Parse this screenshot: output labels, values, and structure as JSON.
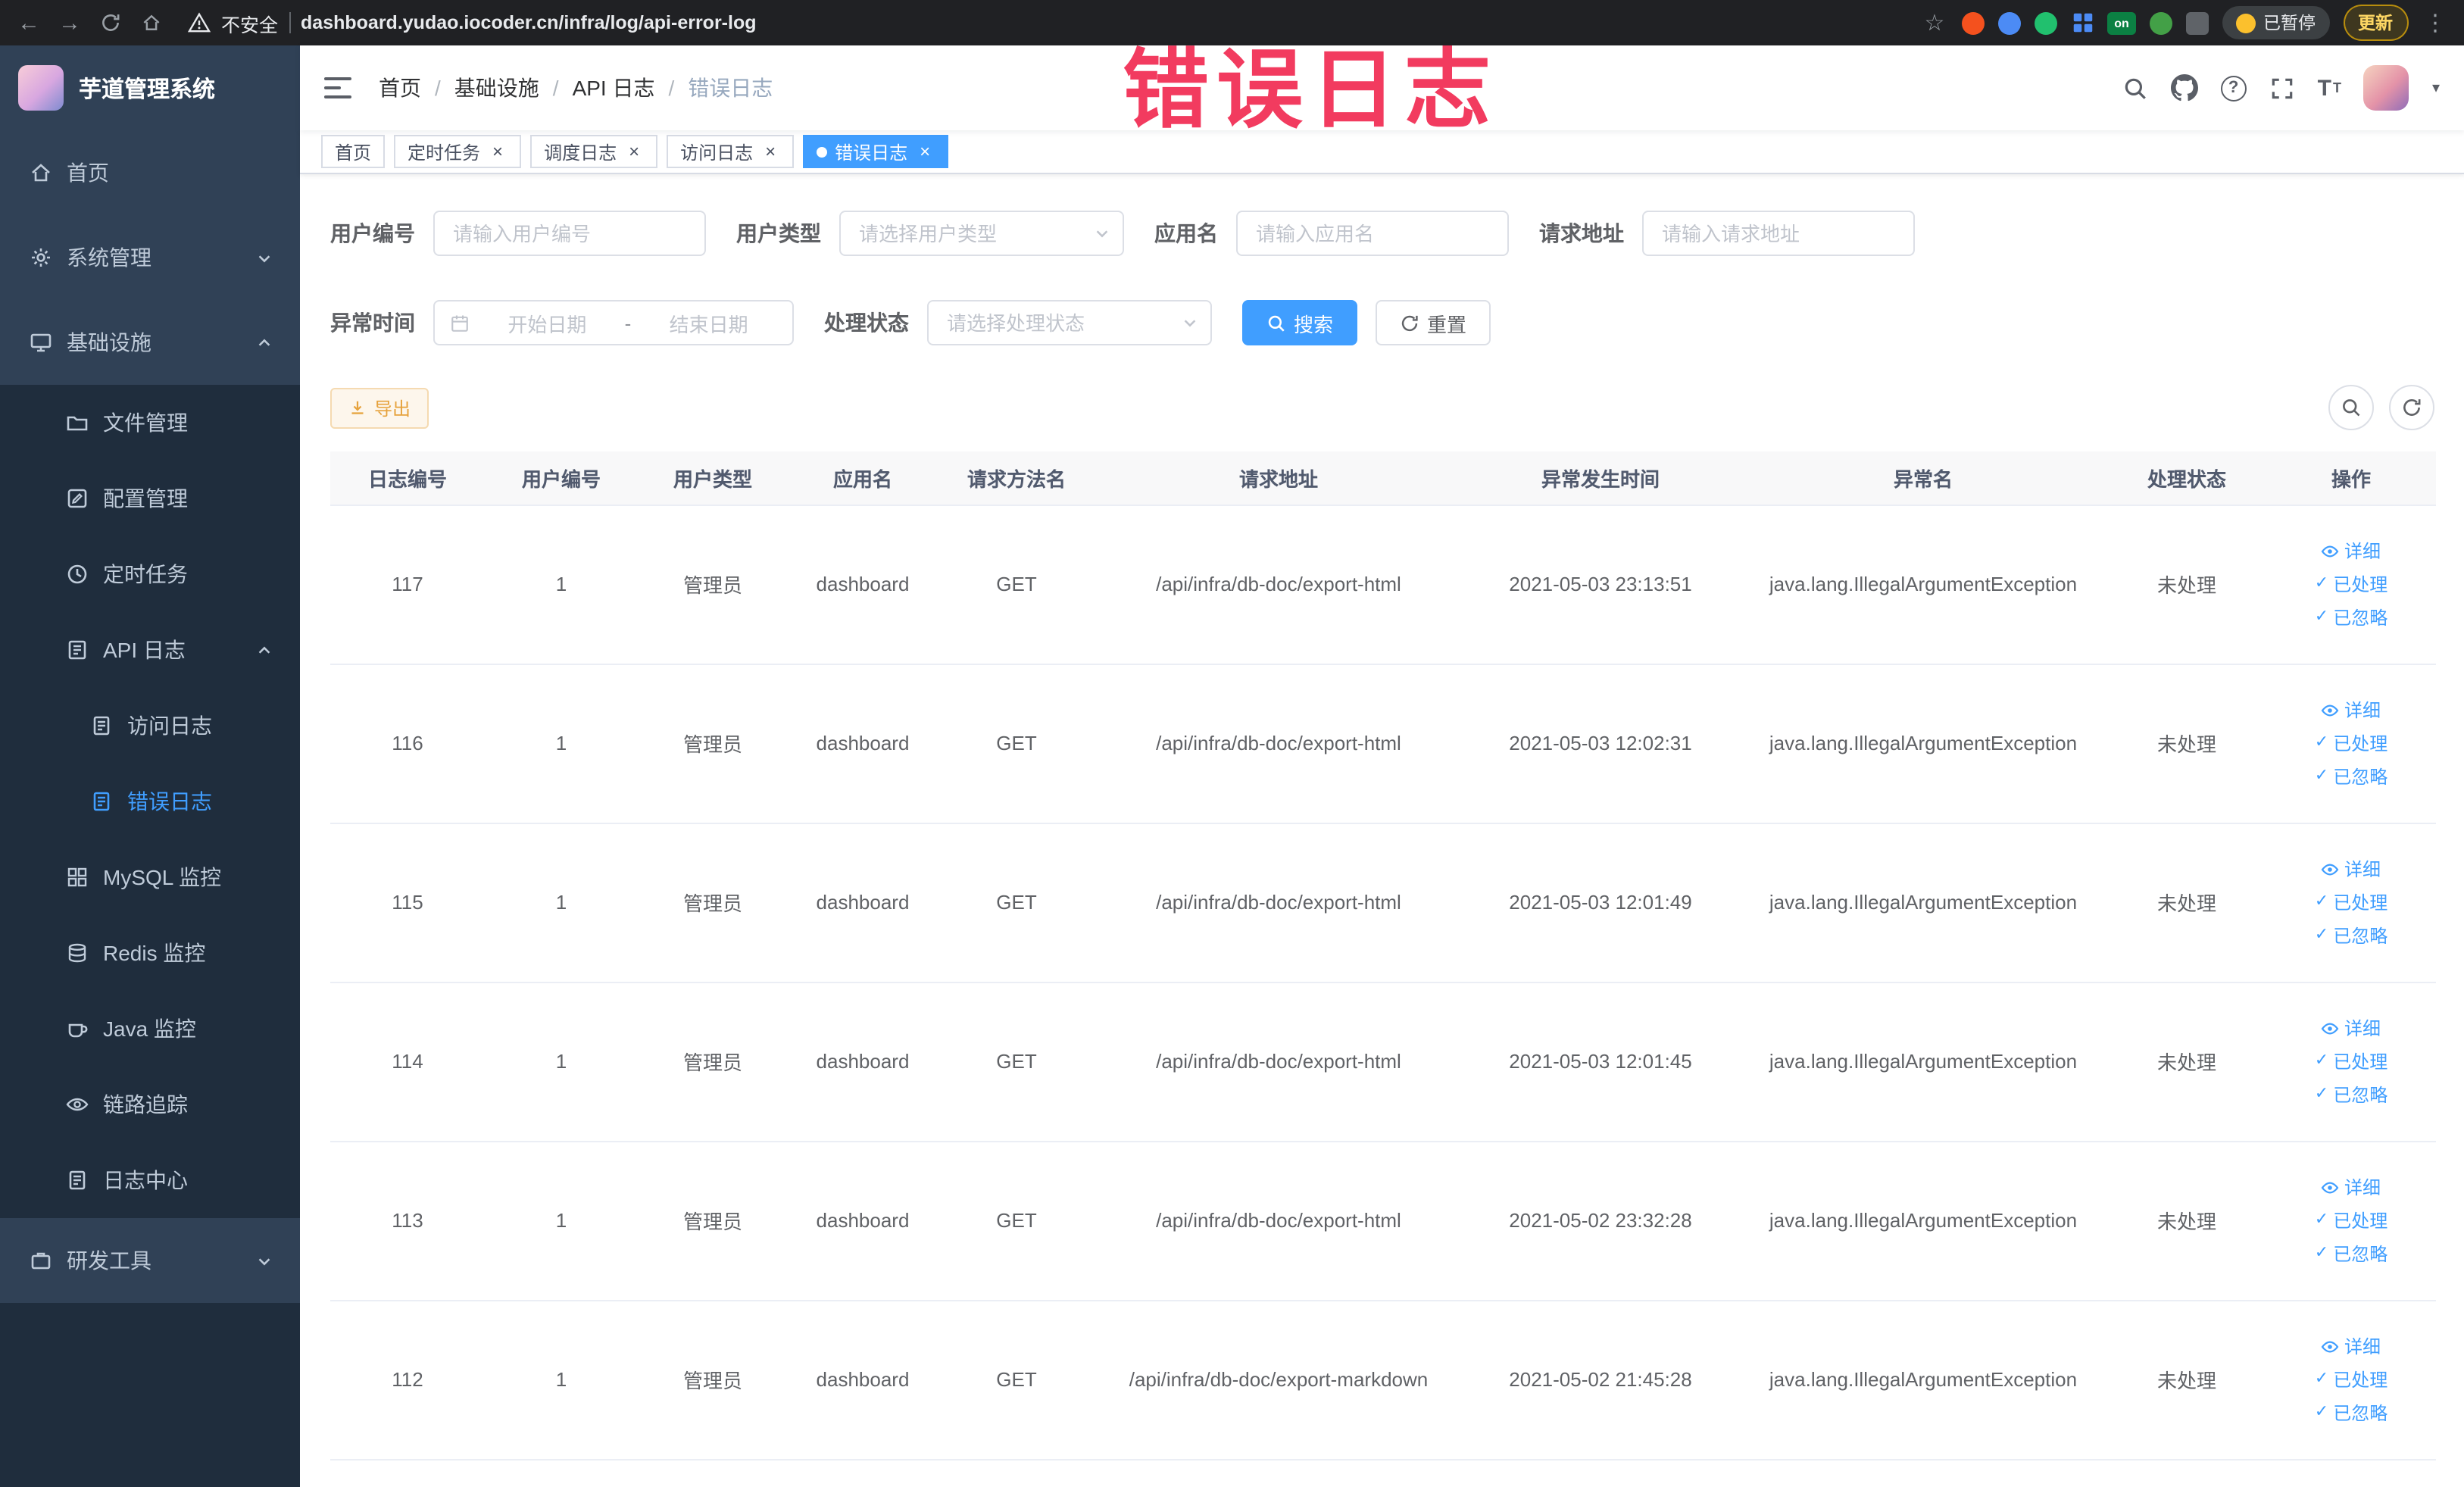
{
  "watermark": "错误日志",
  "icons": {
    "back": "←",
    "forward": "→",
    "star": "☆",
    "kebab": "⋮",
    "close": "×",
    "caret": "▾",
    "check": "✓",
    "help": "?",
    "text_size": "T",
    "breadcrumb_separator": "/",
    "range_separator": "-"
  },
  "colors": {
    "accent": "#409eff",
    "sidebar_bg": "#304156",
    "submenu_bg": "#1f2d3d",
    "warning": "#e6a23c",
    "watermark": "#f23b5f"
  },
  "browser": {
    "security_label": "不安全",
    "url": "dashboard.yudao.iocoder.cn/infra/log/api-error-log",
    "extension_on_badge": "on",
    "paused_badge": "已暂停",
    "update_button": "更新"
  },
  "sidebar": {
    "logo_title": "芋道管理系统",
    "items": [
      {
        "label": "首页"
      },
      {
        "label": "系统管理"
      },
      {
        "label": "基础设施"
      },
      {
        "label": "文件管理"
      },
      {
        "label": "配置管理"
      },
      {
        "label": "定时任务"
      },
      {
        "label": "API 日志"
      },
      {
        "label": "访问日志"
      },
      {
        "label": "错误日志"
      },
      {
        "label": "MySQL 监控"
      },
      {
        "label": "Redis 监控"
      },
      {
        "label": "Java 监控"
      },
      {
        "label": "链路追踪"
      },
      {
        "label": "日志中心"
      },
      {
        "label": "研发工具"
      }
    ]
  },
  "breadcrumb": {
    "items": [
      {
        "label": "首页"
      },
      {
        "label": "基础设施"
      },
      {
        "label": "API 日志"
      },
      {
        "label": "错误日志"
      }
    ]
  },
  "tabs": [
    {
      "label": "首页"
    },
    {
      "label": "定时任务"
    },
    {
      "label": "调度日志"
    },
    {
      "label": "访问日志"
    },
    {
      "label": "错误日志"
    }
  ],
  "filters": {
    "user_id_label": "用户编号",
    "user_id_placeholder": "请输入用户编号",
    "user_type_label": "用户类型",
    "user_type_placeholder": "请选择用户类型",
    "app_name_label": "应用名",
    "app_name_placeholder": "请输入应用名",
    "request_url_label": "请求地址",
    "request_url_placeholder": "请输入请求地址",
    "exception_time_label": "异常时间",
    "start_date_placeholder": "开始日期",
    "end_date_placeholder": "结束日期",
    "process_status_label": "处理状态",
    "process_status_placeholder": "请选择处理状态",
    "search_button": "搜索",
    "reset_button": "重置"
  },
  "toolbar": {
    "export_button": "导出"
  },
  "table": {
    "headers": [
      "日志编号",
      "用户编号",
      "用户类型",
      "应用名",
      "请求方法名",
      "请求地址",
      "异常发生时间",
      "异常名",
      "处理状态",
      "操作"
    ],
    "action_labels": {
      "detail": "详细",
      "processed": "已处理",
      "ignored": "已忽略"
    },
    "rows": [
      {
        "id": "117",
        "user_id": "1",
        "user_type": "管理员",
        "app": "dashboard",
        "method": "GET",
        "url": "/api/infra/db-doc/export-html",
        "time": "2021-05-03 23:13:51",
        "exception": "java.lang.IllegalArgumentException",
        "status": "未处理"
      },
      {
        "id": "116",
        "user_id": "1",
        "user_type": "管理员",
        "app": "dashboard",
        "method": "GET",
        "url": "/api/infra/db-doc/export-html",
        "time": "2021-05-03 12:02:31",
        "exception": "java.lang.IllegalArgumentException",
        "status": "未处理"
      },
      {
        "id": "115",
        "user_id": "1",
        "user_type": "管理员",
        "app": "dashboard",
        "method": "GET",
        "url": "/api/infra/db-doc/export-html",
        "time": "2021-05-03 12:01:49",
        "exception": "java.lang.IllegalArgumentException",
        "status": "未处理"
      },
      {
        "id": "114",
        "user_id": "1",
        "user_type": "管理员",
        "app": "dashboard",
        "method": "GET",
        "url": "/api/infra/db-doc/export-html",
        "time": "2021-05-03 12:01:45",
        "exception": "java.lang.IllegalArgumentException",
        "status": "未处理"
      },
      {
        "id": "113",
        "user_id": "1",
        "user_type": "管理员",
        "app": "dashboard",
        "method": "GET",
        "url": "/api/infra/db-doc/export-html",
        "time": "2021-05-02 23:32:28",
        "exception": "java.lang.IllegalArgumentException",
        "status": "未处理"
      },
      {
        "id": "112",
        "user_id": "1",
        "user_type": "管理员",
        "app": "dashboard",
        "method": "GET",
        "url": "/api/infra/db-doc/export-markdown",
        "time": "2021-05-02 21:45:28",
        "exception": "java.lang.IllegalArgumentException",
        "status": "未处理"
      }
    ]
  }
}
